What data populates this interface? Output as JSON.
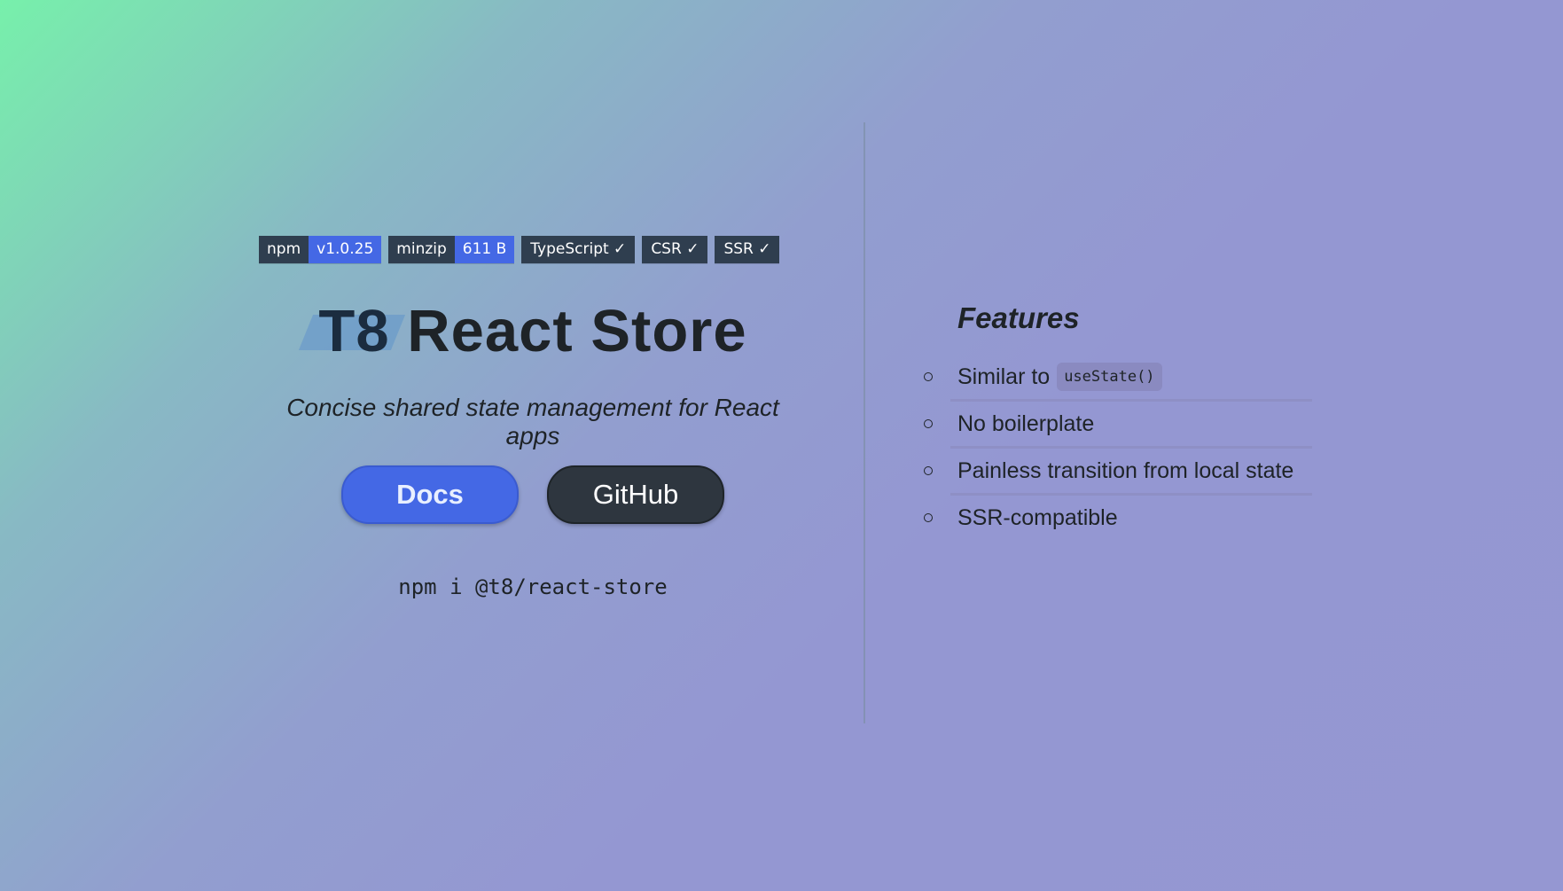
{
  "badges": [
    {
      "key": "npm",
      "value": "v1.0.25"
    },
    {
      "key": "minzip",
      "value": "611 B"
    },
    {
      "key": "TypeScript ✓"
    },
    {
      "key": "CSR ✓"
    },
    {
      "key": "SSR ✓"
    }
  ],
  "title": {
    "logo": "T8",
    "text": "React Store"
  },
  "subtitle": "Concise shared state management for React apps",
  "buttons": {
    "docs": "Docs",
    "github": "GitHub"
  },
  "install_command": "npm i @t8/react-store",
  "features": {
    "heading": "Features",
    "items": [
      {
        "text": "Similar to",
        "code": "useState()"
      },
      {
        "text": "No boilerplate"
      },
      {
        "text": "Painless transition from local state"
      },
      {
        "text": "SSR-compatible"
      }
    ]
  },
  "colors": {
    "accent": "#4468e5",
    "dark": "#2e363f",
    "badge_bg": "#2f3e4f",
    "text": "#1e2327"
  }
}
